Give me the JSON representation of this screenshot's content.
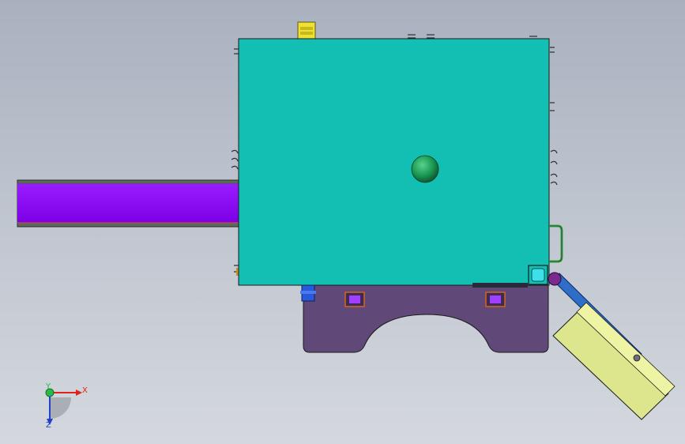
{
  "viewport": {
    "colors": {
      "background_top": "#a9b1bf",
      "background_bottom": "#d4d8de",
      "main_housing": "#13bfb2",
      "beam": "#8b00ff",
      "base": "#604878",
      "plate": "#dde68c",
      "arm": "#2f6ec8",
      "knob": "#1b9a54"
    }
  },
  "triad": {
    "x_label": "X",
    "y_label": "Y",
    "z_label": "Z",
    "x_color": "#e0241c",
    "y_color": "#2bb84a",
    "z_color": "#2340c8"
  }
}
